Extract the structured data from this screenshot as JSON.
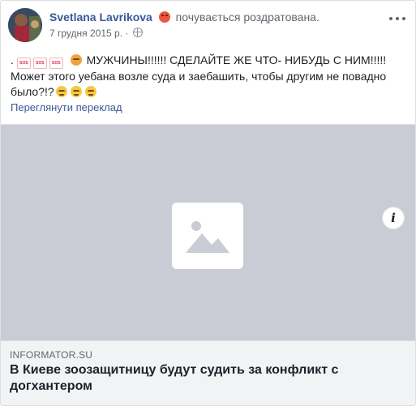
{
  "header": {
    "author_name": "Svetlana Lavrikova",
    "feeling_emoji": "angry-face-emoji",
    "feeling_text": "почувається роздратована.",
    "timestamp": "7 грудня 2015 р.",
    "separator": "·",
    "privacy_icon": "globe-icon",
    "more_icon": "more-dots-icon"
  },
  "post": {
    "lead": ".",
    "sos_label": "SOS",
    "line1": "МУЖЧИНЫ!!!!!! СДЕЛАЙТЕ ЖЕ ЧТО- НИБУДЬ С НИМ!!!!!",
    "line2": "Может этого уебана возле суда и заебашить, чтобы другим не повадно было?!?",
    "translate_label": "Переглянути переклад"
  },
  "link_preview": {
    "image_icon": "image-placeholder-icon",
    "info_label": "i",
    "domain": "INFORMATOR.SU",
    "headline": "В Киеве зоозащитницу будут судить за конфликт с догхантером"
  }
}
